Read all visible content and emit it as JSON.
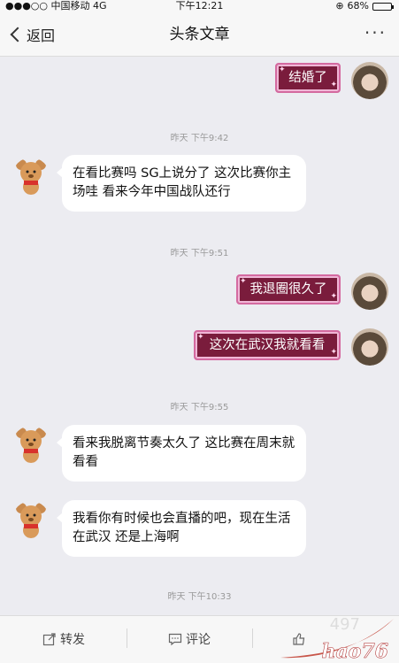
{
  "status_bar": {
    "carrier": "●●●○○ 中国移动  4G",
    "time": "下午12:21",
    "battery_text": "68%",
    "battery_level": 0.68
  },
  "nav": {
    "back_label": "返回",
    "title": "头条文章",
    "more": "···"
  },
  "messages": [
    {
      "side": "right",
      "text": "结婚了"
    },
    {
      "type": "timestamp",
      "text": "昨天 下午9:42"
    },
    {
      "side": "left",
      "text": "在看比赛吗  SG上说分了  这次比赛你主场哇 看来今年中国战队还行"
    },
    {
      "type": "timestamp",
      "text": "昨天 下午9:51"
    },
    {
      "side": "right",
      "text": "我退圈很久了"
    },
    {
      "side": "right",
      "text": "这次在武汉我就看看"
    },
    {
      "type": "timestamp",
      "text": "昨天 下午9:55"
    },
    {
      "side": "left",
      "text": "看来我脱离节奏太久了 这比赛在周末就看看"
    },
    {
      "side": "left",
      "text": "我看你有时候也会直播的吧，现在生活在武汉 还是上海啊"
    },
    {
      "type": "timestamp",
      "text": "昨天 下午10:33"
    }
  ],
  "bottom_bar": {
    "forward": "转发",
    "comment": "评论"
  },
  "watermark": {
    "text": "hao76",
    "number": "497"
  },
  "colors": {
    "accent_bubble": "#7a1c3c",
    "bubble_border": "#d46aa0"
  }
}
